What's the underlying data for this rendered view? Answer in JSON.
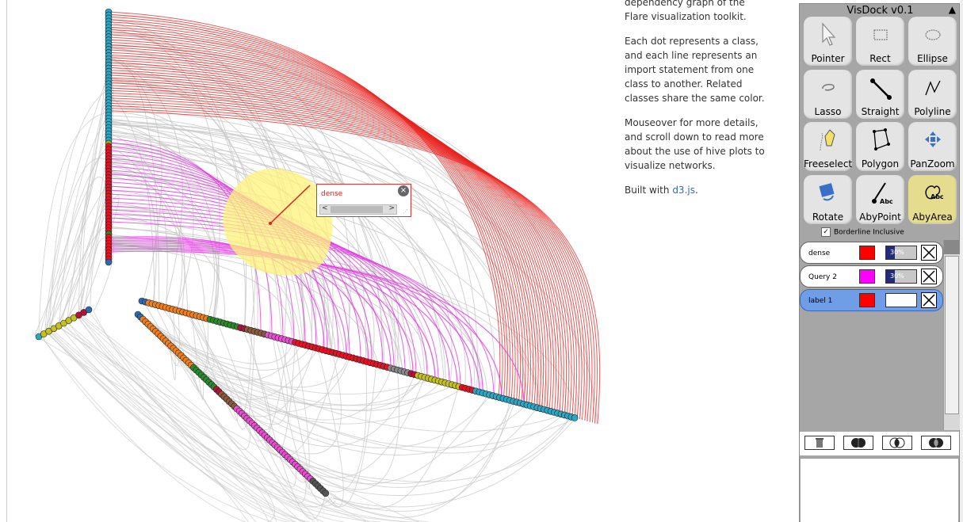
{
  "description": {
    "intro_partial": "dependency graph of the Flare visualization toolkit.",
    "para1": "Each dot represents a class, and each line represents an import statement from one class to another. Related classes share the same color.",
    "para2": "Mouseover for more details, and scroll down to read more about the use of hive plots to visualize networks.",
    "built_prefix": "Built with ",
    "built_link": "d3.js",
    "built_suffix": "."
  },
  "label_popup": {
    "text": "dense",
    "close": "×",
    "scroll_left": "<",
    "scroll_right": ">"
  },
  "dock": {
    "title": "VisDock v0.1",
    "collapse_icon": "triangle-up-icon",
    "tools": [
      {
        "label": "Pointer",
        "icon": "pointer-icon",
        "active": false
      },
      {
        "label": "Rect",
        "icon": "rect-icon",
        "active": false
      },
      {
        "label": "Ellipse",
        "icon": "ellipse-icon",
        "active": false
      },
      {
        "label": "Lasso",
        "icon": "lasso-icon",
        "active": false
      },
      {
        "label": "Straight",
        "icon": "straight-line-icon",
        "active": false
      },
      {
        "label": "Polyline",
        "icon": "polyline-icon",
        "active": false
      },
      {
        "label": "Freeselect",
        "icon": "freeselect-icon",
        "active": false
      },
      {
        "label": "Polygon",
        "icon": "polygon-icon",
        "active": false
      },
      {
        "label": "PanZoom",
        "icon": "panzoom-icon",
        "active": false
      },
      {
        "label": "Rotate",
        "icon": "rotate-icon",
        "active": false
      },
      {
        "label": "AbyPoint",
        "icon": "annotate-point-icon",
        "active": false
      },
      {
        "label": "AbyArea",
        "icon": "annotate-area-icon",
        "active": true
      }
    ],
    "annotation_icon_text": "Abc",
    "borderline_label": "Borderline Inclusive",
    "borderline_checked": true,
    "layers": [
      {
        "name": "dense",
        "color": "#ff0000",
        "opacity": "30%",
        "opacity_fraction": 0.3,
        "selected": false
      },
      {
        "name": "Query 2",
        "color": "#ff00ff",
        "opacity": "30%",
        "opacity_fraction": 0.3,
        "selected": false
      },
      {
        "name": "label 1",
        "color": "#ff0000",
        "opacity": "",
        "opacity_fraction": 0,
        "selected": true
      }
    ],
    "set_ops": [
      "trash-icon",
      "union-icon",
      "intersect-icon",
      "xor-icon"
    ]
  },
  "colors": {
    "selection_red": "#e8231f",
    "query_magenta": "#e33be3",
    "edge_gray": "#c8c8c8",
    "highlight_yellow": "#fff27a"
  }
}
